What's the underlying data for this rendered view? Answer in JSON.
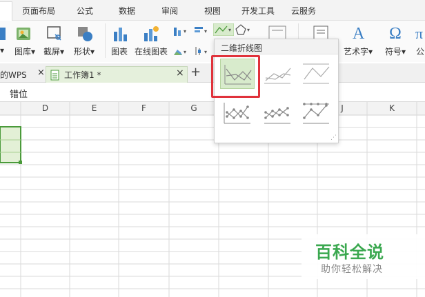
{
  "menu": {
    "items": [
      "页面布局",
      "公式",
      "数据",
      "审阅",
      "视图",
      "开发工具",
      "云服务"
    ]
  },
  "ribbon": {
    "image_label": "图库",
    "screenshot_label": "截屏",
    "shape_label": "形状",
    "chart_label": "图表",
    "online_chart_label": "在线图表",
    "wordart_label": "艺术字",
    "symbol_label": "符号",
    "formula_label": "公"
  },
  "tabs": {
    "prev_tab": "的WPS",
    "active_tab": "工作簿1 *",
    "add": "+"
  },
  "formula_bar": {
    "value": "错位"
  },
  "grid": {
    "columns": [
      "D",
      "E",
      "F",
      "G",
      "J",
      "K"
    ]
  },
  "popup": {
    "title": "二维折线图"
  },
  "watermark": {
    "title": "百科全说",
    "subtitle": "助你轻松解决"
  },
  "colors": {
    "accent_green": "#3aa84f",
    "highlight_red": "#e0323b",
    "selection_green": "#d8ebcc"
  }
}
